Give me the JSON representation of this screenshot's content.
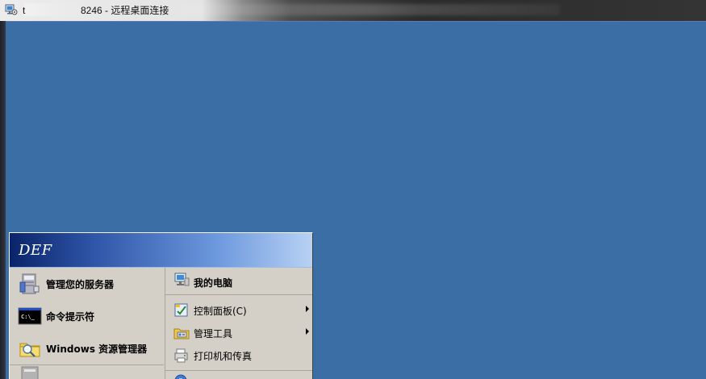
{
  "window": {
    "title_start": "t",
    "title_end": "8246 - 远程桌面连接"
  },
  "start_menu": {
    "user_name": "DEF",
    "left_items": [
      {
        "label": "管理您的服务器",
        "icon": "server-manager-icon"
      },
      {
        "label": "命令提示符",
        "icon": "command-prompt-icon"
      },
      {
        "label": "Windows 资源管理器",
        "icon": "explorer-icon"
      }
    ],
    "right_items": [
      {
        "label": "我的电脑",
        "icon": "my-computer-icon"
      },
      {
        "label": "控制面板(C)",
        "icon": "control-panel-icon"
      },
      {
        "label": "管理工具",
        "icon": "admin-tools-icon"
      },
      {
        "label": "打印机和传真",
        "icon": "printer-fax-icon"
      }
    ]
  },
  "colors": {
    "desktop": "#3a6ea5",
    "start_header_start": "#0a246a",
    "start_header_end": "#b8d2f3",
    "menu_background": "#d4d0c8"
  }
}
